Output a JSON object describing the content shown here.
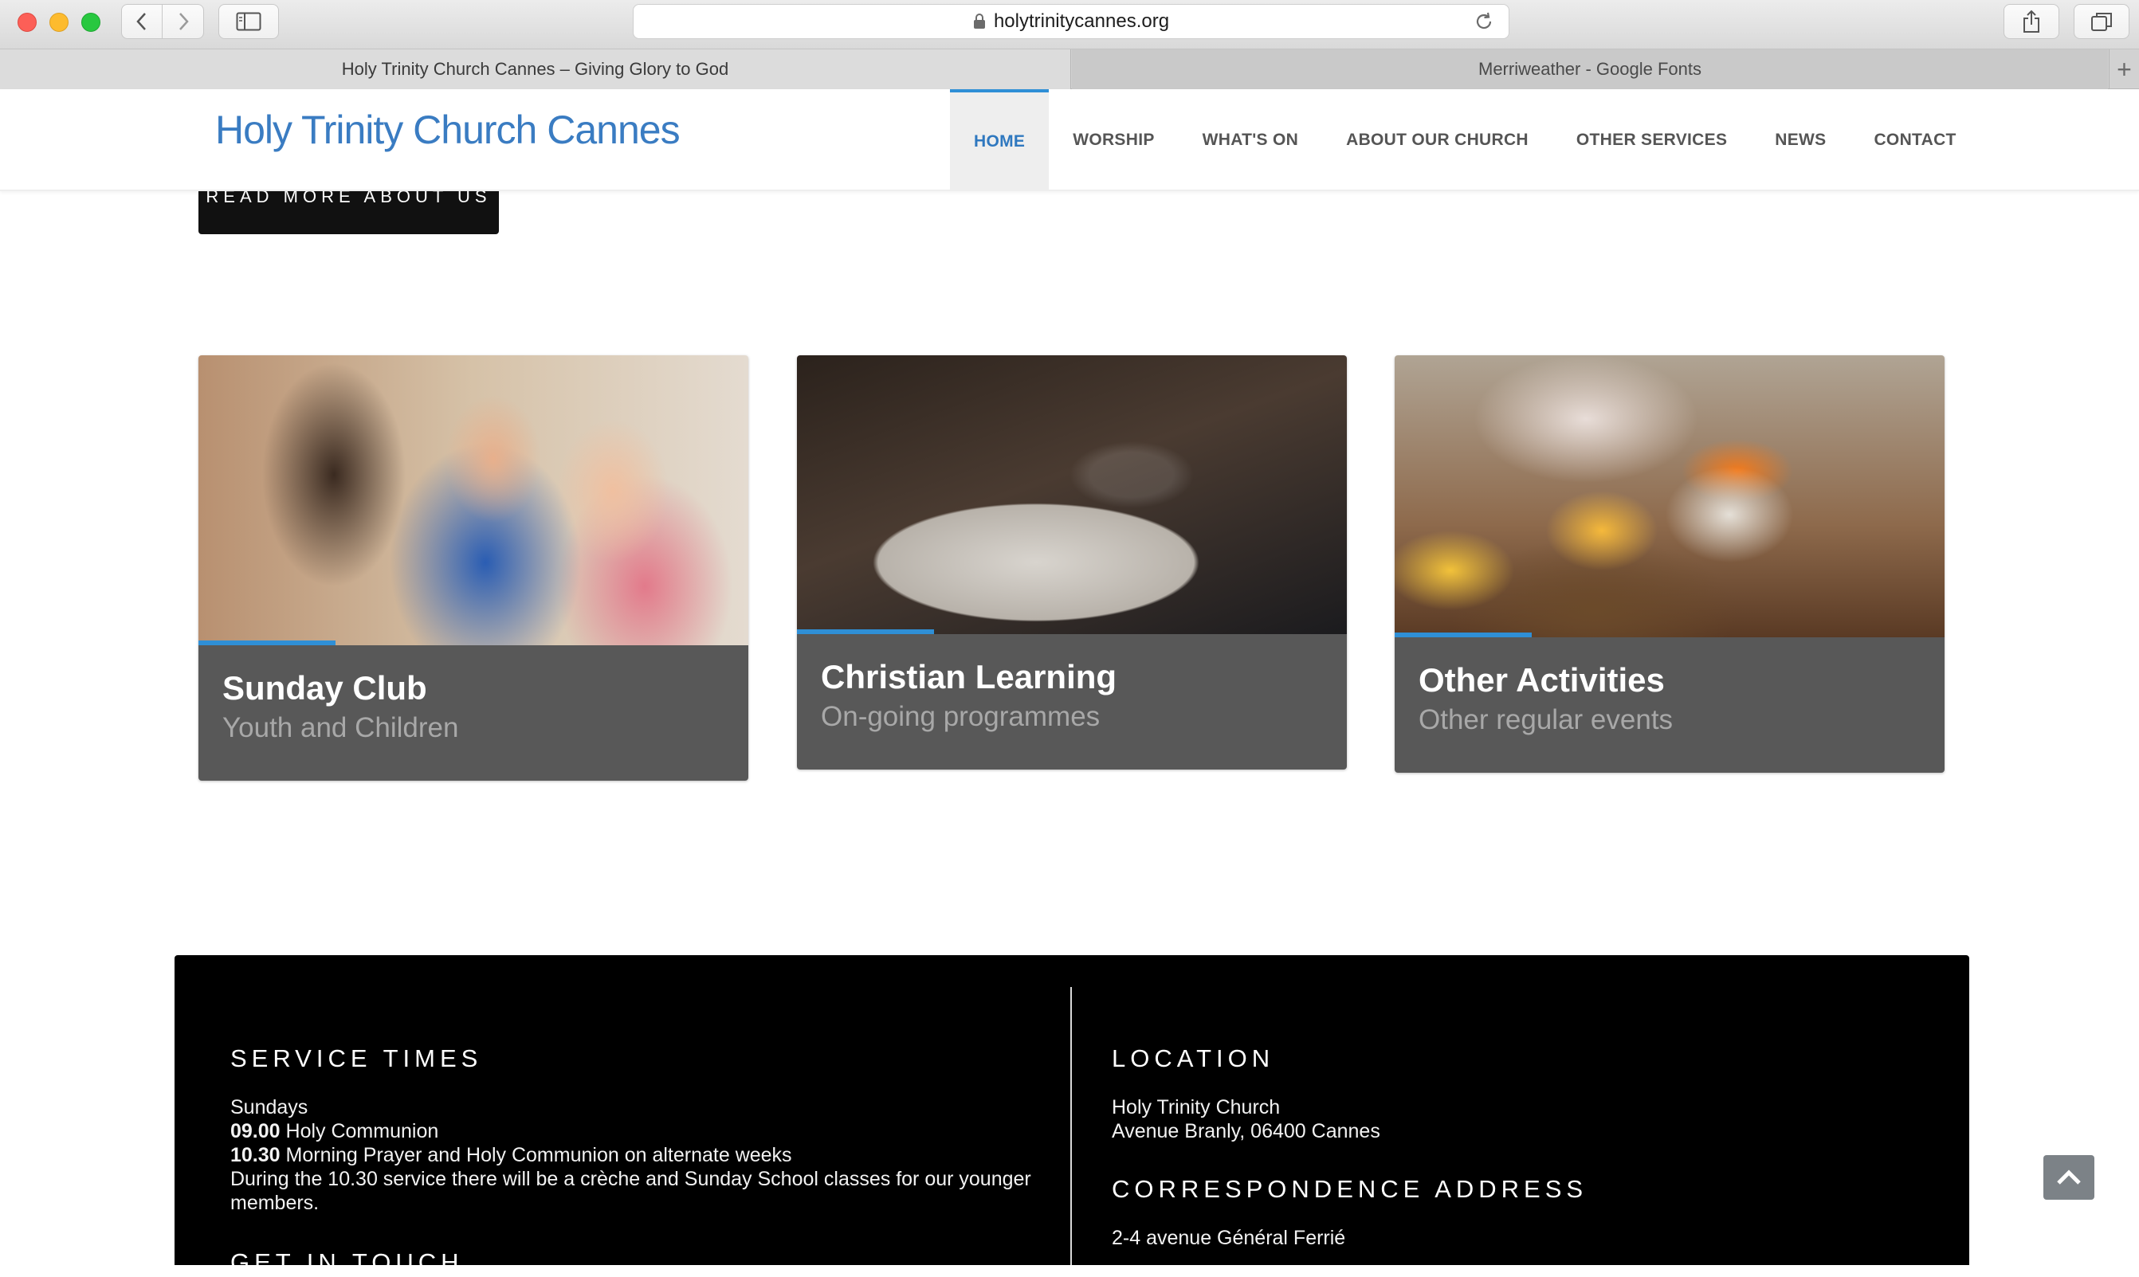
{
  "browser": {
    "url": "holytrinitycannes.org",
    "tabs": [
      {
        "label": "Holy Trinity Church Cannes – Giving Glory to God",
        "active": true
      },
      {
        "label": "Merriweather - Google Fonts",
        "active": false
      }
    ],
    "new_tab_label": "+"
  },
  "header": {
    "logo_text": "Holy Trinity Church Cannes",
    "nav": [
      {
        "label": "HOME",
        "active": true
      },
      {
        "label": "WORSHIP"
      },
      {
        "label": "WHAT'S ON"
      },
      {
        "label": "ABOUT OUR CHURCH"
      },
      {
        "label": "OTHER SERVICES"
      },
      {
        "label": "NEWS"
      },
      {
        "label": "CONTACT"
      }
    ]
  },
  "main": {
    "read_more_label": "READ MORE ABOUT US",
    "cards": [
      {
        "title": "Sunday Club",
        "subtitle": "Youth and Children"
      },
      {
        "title": "Christian Learning",
        "subtitle": "On-going programmes"
      },
      {
        "title": "Other Activities",
        "subtitle": "Other regular events"
      }
    ]
  },
  "info": {
    "service_times": {
      "heading": "SERVICE TIMES",
      "day": "Sundays",
      "time1": "09.00",
      "service1": "Holy Communion",
      "time2": "10.30",
      "service2": "Morning Prayer and Holy Communion on alternate weeks",
      "note": "During the 10.30 service there will be a crèche and Sunday School classes for our younger members."
    },
    "get_in_touch": {
      "heading": "GET IN TOUCH"
    },
    "location": {
      "heading": "LOCATION",
      "line1": "Holy Trinity Church",
      "line2": "Avenue Branly, 06400 Cannes"
    },
    "correspondence": {
      "heading": "CORRESPONDENCE ADDRESS",
      "line1": "2-4 avenue Général Ferrié"
    }
  },
  "colors": {
    "accent_blue": "#2f8fd6",
    "logo_blue": "#3a7cc2",
    "info_bg": "#000000"
  },
  "icons": {
    "back": "chevron-left-icon",
    "forward": "chevron-right-icon",
    "sidebar": "sidebar-icon",
    "lock": "lock-icon",
    "reload": "reload-icon",
    "share": "share-icon",
    "tabs": "tabs-icon",
    "scroll_top": "chevron-up-icon"
  }
}
